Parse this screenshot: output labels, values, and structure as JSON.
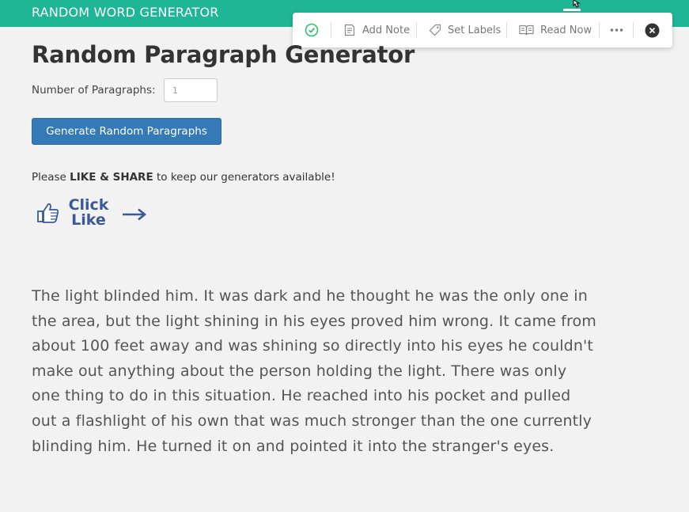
{
  "header": {
    "brand": "RANDOM WORD GENERATOR"
  },
  "toolbar": {
    "add_note": "Add Note",
    "set_labels": "Set Labels",
    "read_now": "Read Now"
  },
  "main": {
    "title": "Random Paragraph Generator",
    "num_paragraphs_label": "Number of Paragraphs:",
    "num_paragraphs_value": "1",
    "generate_button": "Generate Random Paragraphs",
    "share": {
      "prefix": "Please ",
      "bold": "LIKE & SHARE",
      "suffix": " to keep our generators available!"
    },
    "like_badge": {
      "line1": "Click",
      "line2": "Like"
    },
    "paragraph": "The light blinded him. It was dark and he thought he was the only one in the area, but the light shining in his eyes proved him wrong. It came from about 100 feet away and was shining so directly into his eyes he couldn't make out anything about the person holding the light. There was only one thing to do in this situation. He reached into his pocket and pulled out a flashlight of his own that was much stronger than the one currently blinding him. He turned it on and pointed it into the stranger's eyes."
  },
  "colors": {
    "header_bg": "#1fb597",
    "button_bg": "#337ab7",
    "like_blue": "#3b5998",
    "check_green": "#2fbf71"
  },
  "icons": [
    "check-circle-icon",
    "note-icon",
    "tag-icon",
    "book-icon",
    "more-icon",
    "close-icon",
    "thumbs-up-icon",
    "arrow-right-icon",
    "hamburger-menu-icon",
    "mouse-cursor-icon"
  ]
}
